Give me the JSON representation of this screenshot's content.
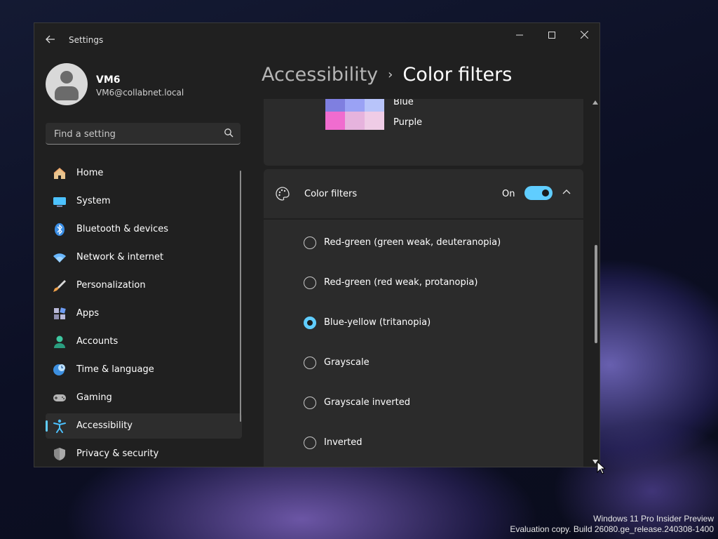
{
  "window": {
    "title": "Settings"
  },
  "user": {
    "name": "VM6",
    "email": "VM6@collabnet.local"
  },
  "search": {
    "placeholder": "Find a setting"
  },
  "nav": [
    {
      "label": "Home",
      "icon": "home-icon"
    },
    {
      "label": "System",
      "icon": "system-icon"
    },
    {
      "label": "Bluetooth & devices",
      "icon": "bluetooth-icon"
    },
    {
      "label": "Network & internet",
      "icon": "wifi-icon"
    },
    {
      "label": "Personalization",
      "icon": "brush-icon"
    },
    {
      "label": "Apps",
      "icon": "apps-icon"
    },
    {
      "label": "Accounts",
      "icon": "accounts-icon"
    },
    {
      "label": "Time & language",
      "icon": "globe-clock-icon"
    },
    {
      "label": "Gaming",
      "icon": "gamepad-icon"
    },
    {
      "label": "Accessibility",
      "icon": "accessibility-icon",
      "selected": true
    },
    {
      "label": "Privacy & security",
      "icon": "shield-icon"
    }
  ],
  "breadcrumb": {
    "parent": "Accessibility",
    "separator": "›",
    "current": "Color filters"
  },
  "preview": {
    "labels": [
      "Blue",
      "Purple"
    ],
    "swatch_colors": [
      "#7f7fe0",
      "#9aa2f5",
      "#b8c4fa",
      "#f06ccf",
      "#e6b3dd",
      "#efcce6"
    ]
  },
  "color_filters": {
    "title": "Color filters",
    "state": "On",
    "enabled": true
  },
  "filter_options": [
    {
      "label": "Red-green (green weak, deuteranopia)",
      "selected": false
    },
    {
      "label": "Red-green (red weak, protanopia)",
      "selected": false
    },
    {
      "label": "Blue-yellow (tritanopia)",
      "selected": true
    },
    {
      "label": "Grayscale",
      "selected": false
    },
    {
      "label": "Grayscale inverted",
      "selected": false
    },
    {
      "label": "Inverted",
      "selected": false
    }
  ],
  "watermark": {
    "line1": "Windows 11 Pro Insider Preview",
    "line2": "Evaluation copy. Build 26080.ge_release.240308-1400"
  },
  "colors": {
    "accent": "#60cdff",
    "window_bg": "#202020",
    "card_bg": "#2b2b2b"
  }
}
